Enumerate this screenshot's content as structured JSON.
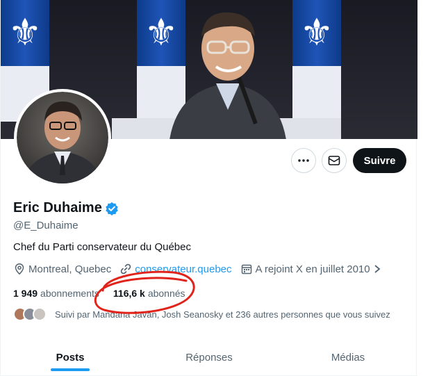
{
  "profile": {
    "name": "Eric Duhaime",
    "handle": "@E_Duhaime",
    "bio": "Chef du Parti conservateur du Québec",
    "location": "Montreal, Quebec",
    "website": "conservateur.quebec",
    "joined": "A rejoint X en juillet 2010",
    "following_count": "1 949",
    "following_label": "abonnements",
    "followers_count": "116,6 k",
    "followers_label": "abonnés",
    "followed_by": "Suivi par Mandana Javan, Josh Seanosky et 236 autres personnes que vous suivez"
  },
  "actions": {
    "follow_label": "Suivre",
    "more_icon": "more-icon",
    "message_icon": "message-icon"
  },
  "tabs": [
    {
      "label": "Posts",
      "active": true
    },
    {
      "label": "Réponses",
      "active": false
    },
    {
      "label": "Médias",
      "active": false
    }
  ],
  "colors": {
    "accent": "#1d9bf0",
    "verified": "#1d9bf0",
    "annotation": "#e0241b"
  }
}
